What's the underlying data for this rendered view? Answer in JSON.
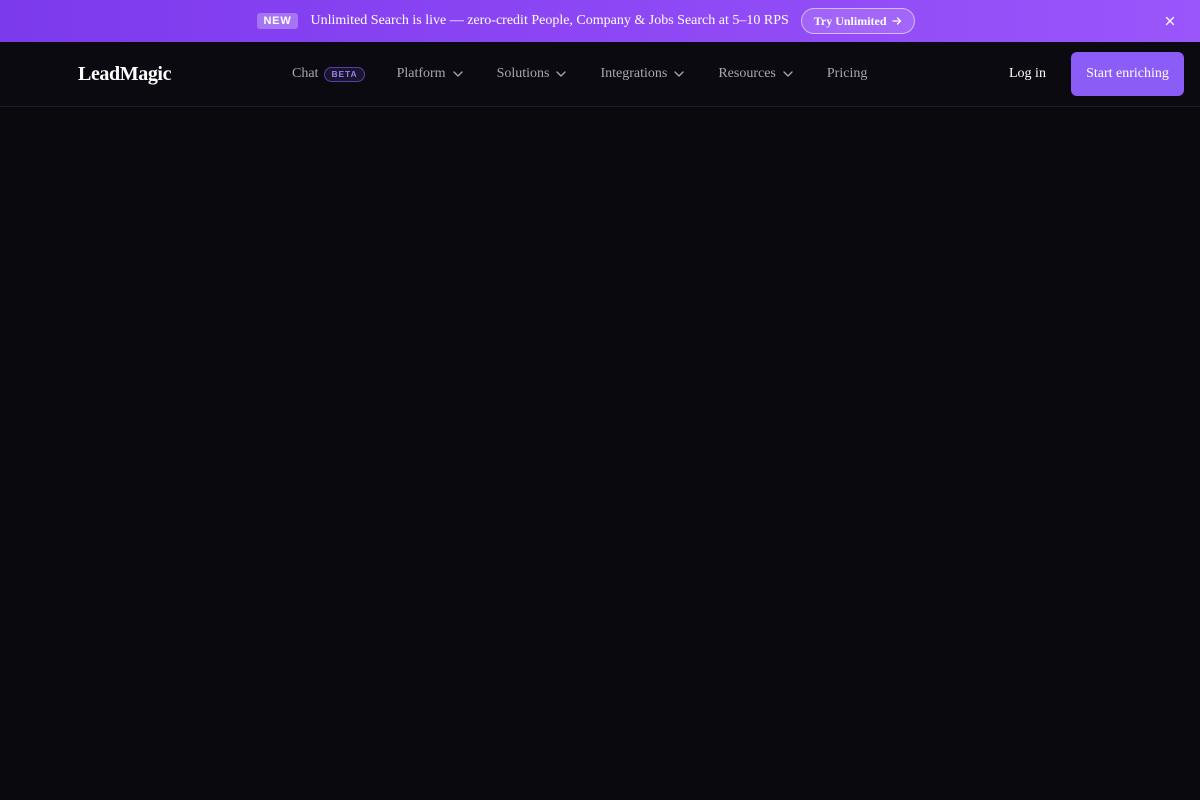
{
  "announcement": {
    "badge": "NEW",
    "text": "Unlimited Search is live — zero-credit People, Company & Jobs Search at 5–10 RPS",
    "cta_label": "Try Unlimited",
    "cta_icon": "arrow-right-icon",
    "close_icon": "close-icon"
  },
  "nav": {
    "logo": "LeadMagic",
    "items": [
      {
        "label": "Chat",
        "badge": "BETA"
      },
      {
        "label": "Platform",
        "icon": "chevron-down-icon"
      },
      {
        "label": "Solutions",
        "icon": "chevron-down-icon"
      },
      {
        "label": "Integrations",
        "icon": "chevron-down-icon"
      },
      {
        "label": "Resources",
        "icon": "chevron-down-icon"
      },
      {
        "label": "Pricing"
      }
    ],
    "login_label": "Log in",
    "cta_label": "Start enriching"
  },
  "colors": {
    "announcement_gradient_start": "#7c3aed",
    "announcement_gradient_end": "#9a55fb",
    "page_background": "#0a090e",
    "cta_background": "#8b5cf6",
    "beta_badge_text": "#9b7df0"
  }
}
